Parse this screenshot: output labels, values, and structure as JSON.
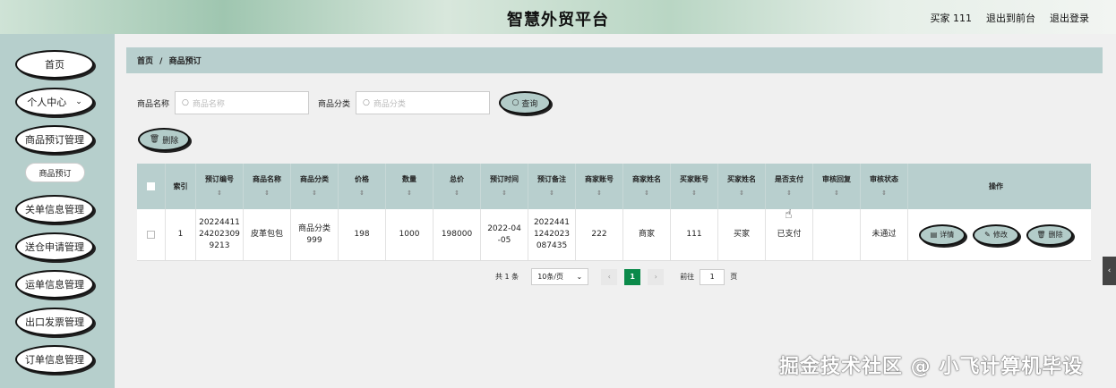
{
  "header": {
    "title": "智慧外贸平台",
    "user": "买家 111",
    "back_front": "退出到前台",
    "logout": "退出登录"
  },
  "sidebar": {
    "items": [
      {
        "label": "首页"
      },
      {
        "label": "个人中心"
      },
      {
        "label": "商品预订管理"
      },
      {
        "label": "商品预订"
      },
      {
        "label": "关单信息管理"
      },
      {
        "label": "送仓申请管理"
      },
      {
        "label": "运单信息管理"
      },
      {
        "label": "出口发票管理"
      },
      {
        "label": "订单信息管理"
      }
    ],
    "chevron": "⌄"
  },
  "breadcrumb": {
    "home": "首页",
    "sep": "/",
    "current": "商品预订"
  },
  "search": {
    "name_label": "商品名称",
    "name_placeholder": "商品名称",
    "category_label": "商品分类",
    "category_placeholder": "商品分类",
    "query_button": "查询",
    "delete_button": "删除"
  },
  "table": {
    "headers": [
      "索引",
      "预订编号",
      "商品名称",
      "商品分类",
      "价格",
      "数量",
      "总价",
      "预订时间",
      "预订备注",
      "商家账号",
      "商家姓名",
      "买家账号",
      "买家姓名",
      "是否支付",
      "审核回复",
      "审核状态",
      "操作"
    ],
    "sort_glyph": "⇕",
    "rows": [
      {
        "index": "1",
        "order_no": "20224411 24202309 9213",
        "product_name": "皮革包包",
        "category": "商品分类 999",
        "price": "198",
        "qty": "1000",
        "total": "198000",
        "time": "2022-04 -05",
        "remark": "2022441 1242023 087435",
        "seller_account": "222",
        "seller_name": "商家",
        "buyer_account": "111",
        "buyer_name": "买家",
        "paid": "已支付",
        "reply": "",
        "status": "未通过",
        "ops": {
          "detail": "详情",
          "edit": "修改",
          "delete": "删除"
        }
      }
    ]
  },
  "pagination": {
    "total": "共 1 条",
    "page_size": "10条/页",
    "current": "1",
    "goto_label": "前往",
    "goto_value": "1",
    "page_unit": "页"
  },
  "watermark": "掘金技术社区 @ 小飞计算机毕设"
}
